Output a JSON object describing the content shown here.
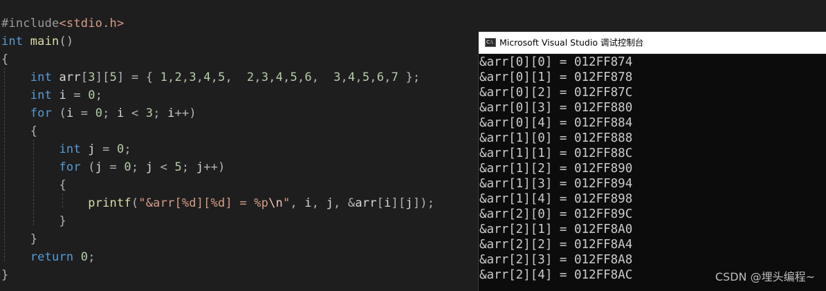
{
  "editor": {
    "lines": [
      [
        {
          "t": "#include",
          "c": "pre"
        },
        {
          "t": "<stdio.h>",
          "c": "hdr"
        }
      ],
      [
        {
          "t": "int",
          "c": "kw"
        },
        {
          "t": " ",
          "c": "pn"
        },
        {
          "t": "main",
          "c": "fn"
        },
        {
          "t": "()",
          "c": "pn"
        }
      ],
      [
        {
          "t": "{",
          "c": "pn"
        }
      ],
      [
        {
          "t": "    ",
          "c": "pn"
        },
        {
          "t": "int",
          "c": "kw"
        },
        {
          "t": " ",
          "c": "pn"
        },
        {
          "t": "arr",
          "c": "id"
        },
        {
          "t": "[",
          "c": "pn"
        },
        {
          "t": "3",
          "c": "num"
        },
        {
          "t": "][",
          "c": "pn"
        },
        {
          "t": "5",
          "c": "num"
        },
        {
          "t": "] = { ",
          "c": "pn"
        },
        {
          "t": "1",
          "c": "num"
        },
        {
          "t": ",",
          "c": "pn"
        },
        {
          "t": "2",
          "c": "num"
        },
        {
          "t": ",",
          "c": "pn"
        },
        {
          "t": "3",
          "c": "num"
        },
        {
          "t": ",",
          "c": "pn"
        },
        {
          "t": "4",
          "c": "num"
        },
        {
          "t": ",",
          "c": "pn"
        },
        {
          "t": "5",
          "c": "num"
        },
        {
          "t": ",  ",
          "c": "pn"
        },
        {
          "t": "2",
          "c": "num"
        },
        {
          "t": ",",
          "c": "pn"
        },
        {
          "t": "3",
          "c": "num"
        },
        {
          "t": ",",
          "c": "pn"
        },
        {
          "t": "4",
          "c": "num"
        },
        {
          "t": ",",
          "c": "pn"
        },
        {
          "t": "5",
          "c": "num"
        },
        {
          "t": ",",
          "c": "pn"
        },
        {
          "t": "6",
          "c": "num"
        },
        {
          "t": ",  ",
          "c": "pn"
        },
        {
          "t": "3",
          "c": "num"
        },
        {
          "t": ",",
          "c": "pn"
        },
        {
          "t": "4",
          "c": "num"
        },
        {
          "t": ",",
          "c": "pn"
        },
        {
          "t": "5",
          "c": "num"
        },
        {
          "t": ",",
          "c": "pn"
        },
        {
          "t": "6",
          "c": "num"
        },
        {
          "t": ",",
          "c": "pn"
        },
        {
          "t": "7",
          "c": "num"
        },
        {
          "t": " };",
          "c": "pn"
        }
      ],
      [
        {
          "t": "    ",
          "c": "pn"
        },
        {
          "t": "int",
          "c": "kw"
        },
        {
          "t": " ",
          "c": "pn"
        },
        {
          "t": "i",
          "c": "id"
        },
        {
          "t": " = ",
          "c": "pn"
        },
        {
          "t": "0",
          "c": "num"
        },
        {
          "t": ";",
          "c": "pn"
        }
      ],
      [
        {
          "t": "    ",
          "c": "pn"
        },
        {
          "t": "for",
          "c": "kw"
        },
        {
          "t": " (",
          "c": "pn"
        },
        {
          "t": "i",
          "c": "id"
        },
        {
          "t": " = ",
          "c": "pn"
        },
        {
          "t": "0",
          "c": "num"
        },
        {
          "t": "; ",
          "c": "pn"
        },
        {
          "t": "i",
          "c": "id"
        },
        {
          "t": " < ",
          "c": "pn"
        },
        {
          "t": "3",
          "c": "num"
        },
        {
          "t": "; ",
          "c": "pn"
        },
        {
          "t": "i",
          "c": "id"
        },
        {
          "t": "++)",
          "c": "pn"
        }
      ],
      [
        {
          "t": "    {",
          "c": "pn"
        }
      ],
      [
        {
          "t": "        ",
          "c": "pn"
        },
        {
          "t": "int",
          "c": "kw"
        },
        {
          "t": " ",
          "c": "pn"
        },
        {
          "t": "j",
          "c": "id"
        },
        {
          "t": " = ",
          "c": "pn"
        },
        {
          "t": "0",
          "c": "num"
        },
        {
          "t": ";",
          "c": "pn"
        }
      ],
      [
        {
          "t": "        ",
          "c": "pn"
        },
        {
          "t": "for",
          "c": "kw"
        },
        {
          "t": " (",
          "c": "pn"
        },
        {
          "t": "j",
          "c": "id"
        },
        {
          "t": " = ",
          "c": "pn"
        },
        {
          "t": "0",
          "c": "num"
        },
        {
          "t": "; ",
          "c": "pn"
        },
        {
          "t": "j",
          "c": "id"
        },
        {
          "t": " < ",
          "c": "pn"
        },
        {
          "t": "5",
          "c": "num"
        },
        {
          "t": "; ",
          "c": "pn"
        },
        {
          "t": "j",
          "c": "id"
        },
        {
          "t": "++)",
          "c": "pn"
        }
      ],
      [
        {
          "t": "        {",
          "c": "pn"
        }
      ],
      [
        {
          "t": "            ",
          "c": "pn"
        },
        {
          "t": "printf",
          "c": "fn"
        },
        {
          "t": "(",
          "c": "pn"
        },
        {
          "t": "\"&arr[%d][%d] = %p",
          "c": "str"
        },
        {
          "t": "\\n",
          "c": "esc"
        },
        {
          "t": "\"",
          "c": "str"
        },
        {
          "t": ", ",
          "c": "pn"
        },
        {
          "t": "i",
          "c": "id"
        },
        {
          "t": ", ",
          "c": "pn"
        },
        {
          "t": "j",
          "c": "id"
        },
        {
          "t": ", &",
          "c": "pn"
        },
        {
          "t": "arr",
          "c": "id"
        },
        {
          "t": "[",
          "c": "pn"
        },
        {
          "t": "i",
          "c": "id"
        },
        {
          "t": "][",
          "c": "pn"
        },
        {
          "t": "j",
          "c": "id"
        },
        {
          "t": "]);",
          "c": "pn"
        }
      ],
      [
        {
          "t": "        }",
          "c": "pn"
        }
      ],
      [
        {
          "t": "    }",
          "c": "pn"
        }
      ],
      [
        {
          "t": "    ",
          "c": "pn"
        },
        {
          "t": "return",
          "c": "kw"
        },
        {
          "t": " ",
          "c": "pn"
        },
        {
          "t": "0",
          "c": "num"
        },
        {
          "t": ";",
          "c": "pn"
        }
      ],
      [
        {
          "t": "}",
          "c": "pn"
        }
      ]
    ]
  },
  "console": {
    "title": "Microsoft Visual Studio 调试控制台",
    "icon": "visual-studio-console-icon",
    "icon_glyph": "C:\\",
    "output": [
      "&arr[0][0] = 012FF874",
      "&arr[0][1] = 012FF878",
      "&arr[0][2] = 012FF87C",
      "&arr[0][3] = 012FF880",
      "&arr[0][4] = 012FF884",
      "&arr[1][0] = 012FF888",
      "&arr[1][1] = 012FF88C",
      "&arr[1][2] = 012FF890",
      "&arr[1][3] = 012FF894",
      "&arr[1][4] = 012FF898",
      "&arr[2][0] = 012FF89C",
      "&arr[2][1] = 012FF8A0",
      "&arr[2][2] = 012FF8A4",
      "&arr[2][3] = 012FF8A8",
      "&arr[2][4] = 012FF8AC"
    ]
  },
  "watermark": "CSDN @埋头编程~",
  "colors": {
    "editor_bg": "#1e1e1e",
    "keyword": "#569cd6",
    "function": "#dcdcaa",
    "string": "#d69d85",
    "number": "#b5cea8",
    "console_bg": "#0c0c0c",
    "console_text": "#cccccc"
  }
}
